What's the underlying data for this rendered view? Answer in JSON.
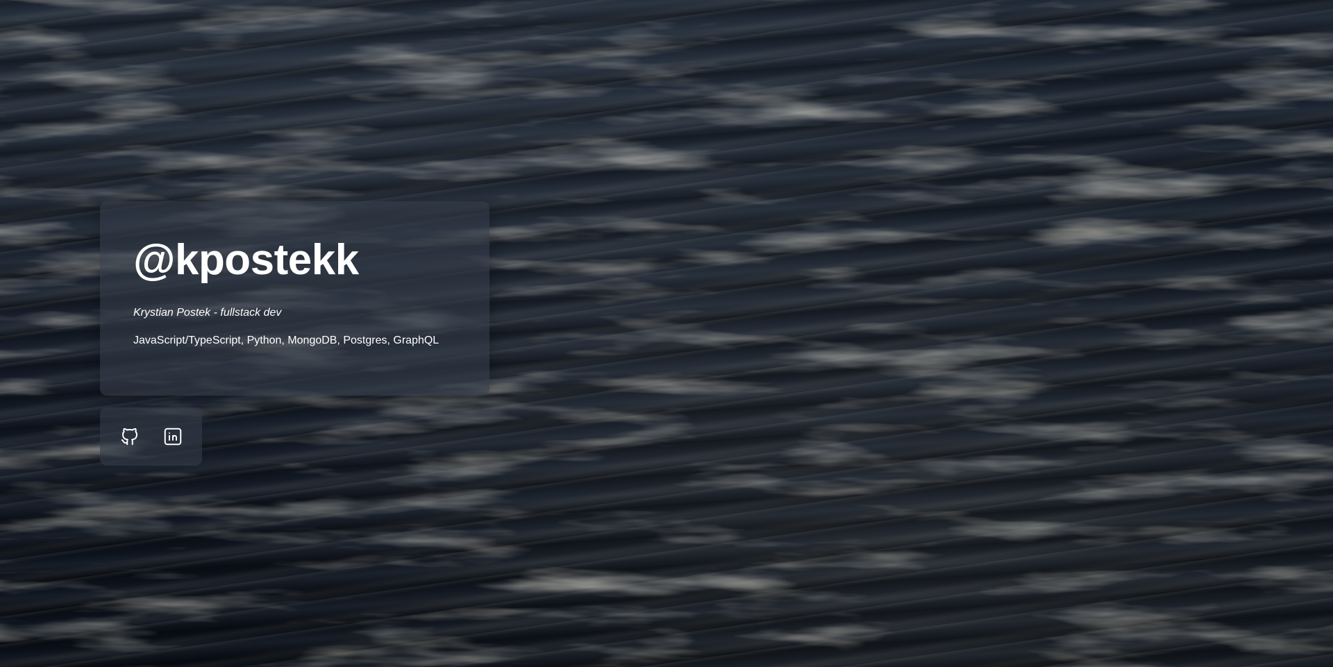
{
  "profile": {
    "handle": "@kpostekk",
    "tagline": "Krystian Postek - fullstack dev",
    "skills": "JavaScript/TypeScript, Python, MongoDB, Postgres, GraphQL"
  },
  "social": {
    "links": [
      {
        "icon": "github-icon"
      },
      {
        "icon": "linkedin-icon"
      }
    ]
  },
  "colors": {
    "text": "#ffffff",
    "card_background": "rgba(52,60,72,0.62)",
    "ocean_dark": "#0a0f18",
    "ocean_mid": "#1b2431"
  }
}
